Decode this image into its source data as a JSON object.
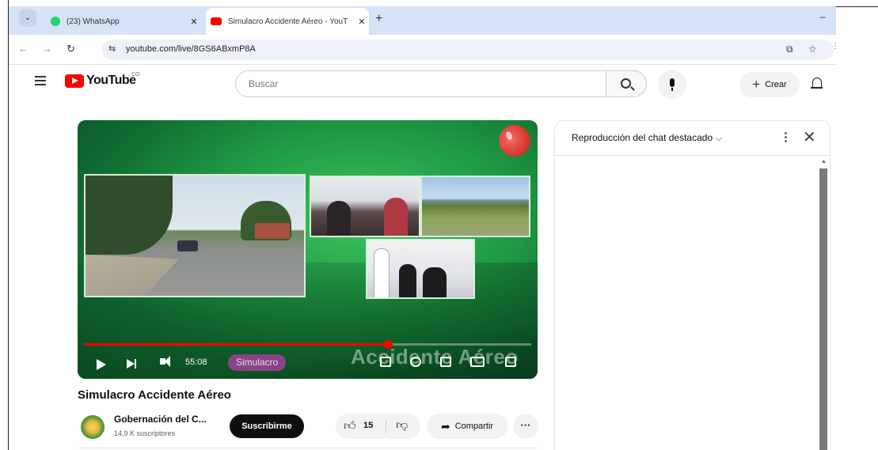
{
  "browser": {
    "tabs": [
      {
        "title": "(23) WhatsApp",
        "close": "✕",
        "favicon": "whatsapp-icon"
      },
      {
        "title": "Simulacro Accidente Aéreo - YouT",
        "close": "✕",
        "favicon": "youtube-icon"
      }
    ],
    "tab_menu": "⌄",
    "new_tab": "+",
    "minimize": "–",
    "back": "←",
    "forward": "→",
    "reload": "↻",
    "site_info": "⇆",
    "url": "youtube.com/live/8GS6ABxmP8A",
    "cast": "⧉",
    "bookmark": "☆",
    "extensions": "⋮"
  },
  "youtube": {
    "logo_text": "YouTube",
    "logo_country": "CO",
    "search_placeholder": "Buscar",
    "create_label": "Crear",
    "create_plus": "+"
  },
  "video": {
    "time": "55:08",
    "chip_text": "Simulacro",
    "overlay_title": "Accidente Aéreo",
    "progress_fraction": 0.68,
    "title": "Simulacro Accidente Aéreo",
    "channel": "Gobernación del C...",
    "subscribers": "14,9 K suscriptores",
    "subscribe_label": "Suscribirme",
    "likes": "15",
    "share_label": "Compartir",
    "more": "···"
  },
  "chat": {
    "title": "Reproducción del chat destacado",
    "chevron": "⌵",
    "menu": "⋮",
    "close": "✕",
    "scroll_up": "▲"
  },
  "colors": {
    "accent": "#ff0000",
    "tabstrip": "#d6e2f6",
    "subscribe_bg": "#0f0f0f",
    "player_green": "#1f9a45"
  }
}
